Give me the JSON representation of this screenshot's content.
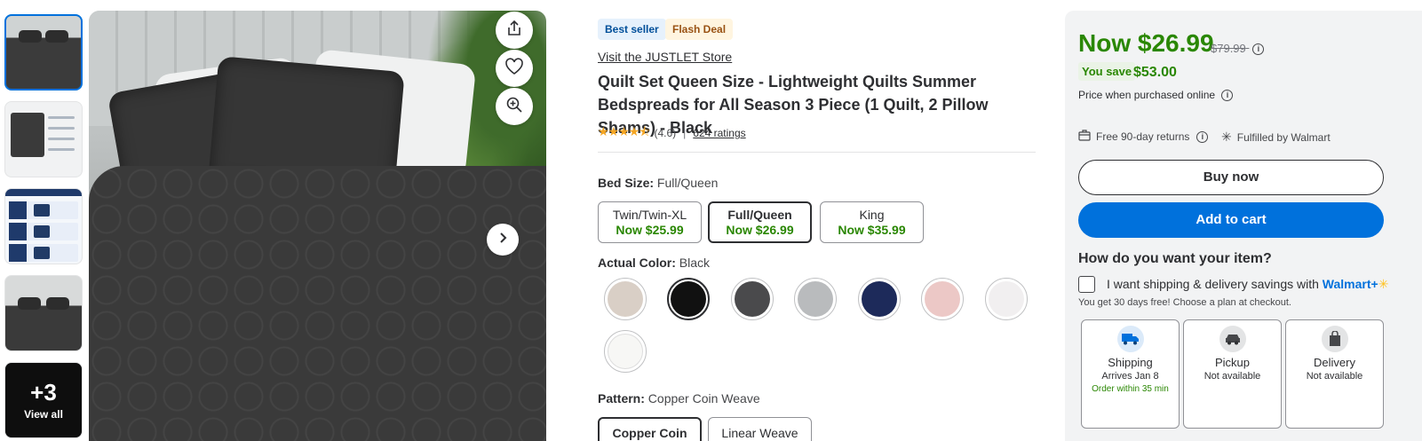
{
  "thumbnails": {
    "more_count": "+3",
    "more_label": "View all"
  },
  "badges": {
    "best_seller": "Best seller",
    "flash_deal": "Flash Deal"
  },
  "product": {
    "store_link": "Visit the JUSTLET Store",
    "title": "Quilt Set Queen Size - Lightweight Quilts Summer Bedspreads for All Season 3 Piece (1 Quilt, 2 Pillow Shams) - Black",
    "stars": "★★★★⯪",
    "rating_value": 4.6,
    "rating": "(4.6)",
    "rating_sep": "|",
    "ratings_count": "624 ratings"
  },
  "bed_size": {
    "label": "Bed Size:",
    "selected": "Full/Queen",
    "options": [
      {
        "name": "Twin/Twin-XL",
        "price": "Now $25.99"
      },
      {
        "name": "Full/Queen",
        "price": "Now $26.99"
      },
      {
        "name": "King",
        "price": "Now $35.99"
      }
    ]
  },
  "color": {
    "label": "Actual Color:",
    "selected": "Black",
    "swatches": [
      {
        "name": "beige",
        "hex": "#d9cfc6"
      },
      {
        "name": "black",
        "hex": "#111111"
      },
      {
        "name": "dark-grey",
        "hex": "#4a4a4c"
      },
      {
        "name": "light-grey",
        "hex": "#b9bbbd"
      },
      {
        "name": "navy",
        "hex": "#1d2a5a"
      },
      {
        "name": "pink",
        "hex": "#ecc8c6"
      },
      {
        "name": "white",
        "hex": "#f1eff0"
      },
      {
        "name": "cream",
        "hex": "#f7f7f5"
      }
    ]
  },
  "pattern": {
    "label": "Pattern:",
    "selected": "Copper Coin Weave",
    "options": [
      "Copper Coin",
      "Linear Weave"
    ]
  },
  "buybox": {
    "price_now": "Now $26.99",
    "price_was": "$79.99",
    "save_label": "You save",
    "save_amount": "$53.00",
    "price_note": "Price when purchased online",
    "returns": "Free 90-day returns",
    "fulfilled": "Fulfilled by Walmart",
    "buy_now": "Buy now",
    "add_to_cart": "Add to cart",
    "how_title": "How do you want your item?",
    "shipping_savings": "I want shipping & delivery savings with",
    "walmart_plus": "Walmart+",
    "shipping_sub": "You get 30 days free! Choose a plan at checkout.",
    "fulfillment": [
      {
        "name": "Shipping",
        "line": "Arrives Jan 8",
        "green": "Order within 35 min"
      },
      {
        "name": "Pickup",
        "line": "Not available",
        "green": ""
      },
      {
        "name": "Delivery",
        "line": "Not available",
        "green": ""
      }
    ]
  },
  "colors": {
    "accent": "#0071dc",
    "price_green": "#2a8703"
  }
}
